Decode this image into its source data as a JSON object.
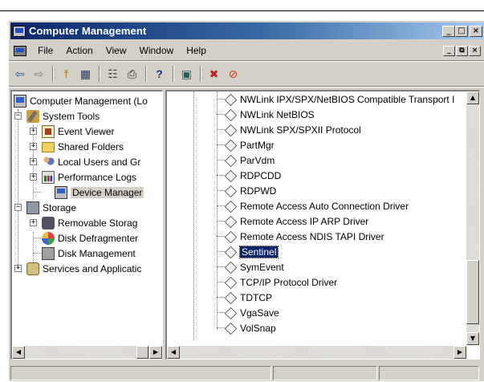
{
  "window": {
    "title": "Computer Management",
    "title_buttons": [
      "_",
      "□",
      "×"
    ]
  },
  "menubar": {
    "items": [
      "File",
      "Action",
      "View",
      "Window",
      "Help"
    ],
    "mdi_buttons": [
      "_",
      "⧉",
      "×"
    ]
  },
  "toolbar": {
    "buttons": [
      "back-icon",
      "forward-icon",
      "up-folder-icon",
      "show-hide-tree-icon",
      "properties-icon",
      "print-icon",
      "help-icon",
      "scan-hardware-icon",
      "uninstall-icon",
      "disable-device-icon"
    ],
    "glyphs": {
      "back": "⇦",
      "forward": "⇨",
      "up": "⤒",
      "tree": "▦",
      "props": "☷",
      "print": "⎙",
      "help": "?",
      "scan": "▣",
      "uninstall": "✖",
      "disable": "⊘"
    }
  },
  "tree": {
    "items": [
      {
        "label": "Computer Management (Lo",
        "icon": "computer-icon",
        "level": 0,
        "expander": ""
      },
      {
        "label": "System Tools",
        "icon": "system-tools-icon",
        "level": 1,
        "expander": "−"
      },
      {
        "label": "Event Viewer",
        "icon": "event-viewer-icon",
        "level": 2,
        "expander": "+"
      },
      {
        "label": "Shared Folders",
        "icon": "shared-folders-icon",
        "level": 2,
        "expander": "+"
      },
      {
        "label": "Local Users and Gr",
        "icon": "local-users-icon",
        "level": 2,
        "expander": "+"
      },
      {
        "label": "Performance Logs",
        "icon": "performance-logs-icon",
        "level": 2,
        "expander": "+"
      },
      {
        "label": "Device Manager",
        "icon": "device-manager-icon",
        "level": 2,
        "expander": "",
        "selected": true
      },
      {
        "label": "Storage",
        "icon": "storage-icon",
        "level": 1,
        "expander": "−"
      },
      {
        "label": "Removable Storag",
        "icon": "removable-storage-icon",
        "level": 2,
        "expander": "+"
      },
      {
        "label": "Disk Defragmenter",
        "icon": "disk-defragmenter-icon",
        "level": 2,
        "expander": ""
      },
      {
        "label": "Disk Management",
        "icon": "disk-management-icon",
        "level": 2,
        "expander": ""
      },
      {
        "label": "Services and Applicatic",
        "icon": "services-applications-icon",
        "level": 1,
        "expander": "+"
      }
    ]
  },
  "devices": {
    "items": [
      "NWLink IPX/SPX/NetBIOS Compatible Transport I",
      "NWLink NetBIOS",
      "NWLink SPX/SPXII Protocol",
      "PartMgr",
      "ParVdm",
      "RDPCDD",
      "RDPWD",
      "Remote Access Auto Connection Driver",
      "Remote Access IP ARP Driver",
      "Remote Access NDIS TAPI Driver",
      "Sentinel",
      "SymEvent",
      "TCP/IP Protocol Driver",
      "TDTCP",
      "VgaSave",
      "VolSnap"
    ],
    "selected": "Sentinel"
  },
  "scroll": {
    "up": "▲",
    "down": "▼",
    "left": "◀",
    "right": "▶"
  }
}
